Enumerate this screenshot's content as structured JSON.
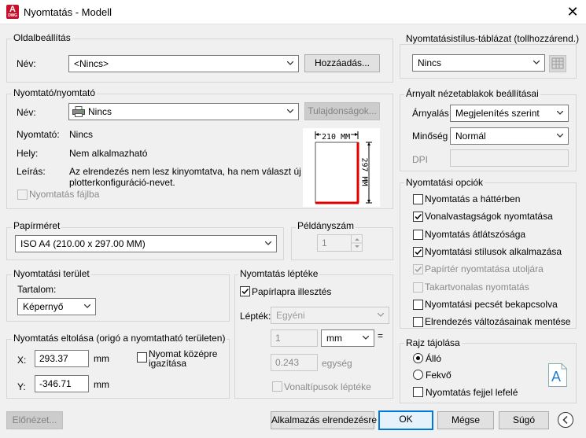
{
  "window": {
    "title": "Nyomtatás - Modell",
    "app_icon_letter": "A",
    "app_icon_sub": "DWG",
    "close": "✕"
  },
  "page_setup": {
    "title": "Oldalbeállítás",
    "name_label": "Név:",
    "name_value": "<Nincs>",
    "add_button": "Hozzáadás..."
  },
  "printer": {
    "title": "Nyomtató/nyomtató",
    "name_label": "Név:",
    "name_value": "Nincs",
    "properties_button": "Tulajdonságok...",
    "plotter_label": "Nyomtató:",
    "plotter_value": "Nincs",
    "where_label": "Hely:",
    "where_value": "Nem alkalmazható",
    "desc_label": "Leírás:",
    "desc_line1": "Az elrendezés nem lesz kinyomtatva, ha nem választ új",
    "desc_line2": "plotterkonfiguráció-nevet.",
    "plot_to_file": "Nyomtatás fájlba"
  },
  "preview": {
    "width": "210 MM",
    "height": "297 MM"
  },
  "paper_size": {
    "title": "Papírméret",
    "value": "ISO A4 (210.00 x 297.00 MM)"
  },
  "copies": {
    "title": "Példányszám",
    "value": "1"
  },
  "plot_area": {
    "title": "Nyomtatási terület",
    "what_label": "Tartalom:",
    "what_value": "Képernyő"
  },
  "plot_offset": {
    "title": "Nyomtatás eltolása (origó a nyomtatható területen)",
    "x_label": "X:",
    "x_value": "293.37",
    "x_unit": "mm",
    "y_label": "Y:",
    "y_value": "-346.71",
    "y_unit": "mm",
    "center_line1": "Nyomat középre",
    "center_line2": "igazítása"
  },
  "plot_scale": {
    "title": "Nyomtatás léptéke",
    "fit_to_paper": "Papírlapra illesztés",
    "scale_label": "Lépték:",
    "scale_value": "Egyéni",
    "value1": "1",
    "unit_value": "mm",
    "equals": "=",
    "value2": "0.243",
    "unit2": "egység",
    "scale_lineweights": "Vonaltípusok léptéke"
  },
  "plot_style": {
    "title": "Nyomtatásistílus-táblázat (tollhozzárend.)",
    "value": "Nincs"
  },
  "shaded": {
    "title": "Árnyalt nézetablakok beállításai",
    "shade_label": "Árnyalás",
    "shade_value": "Megjelenítés szerint",
    "quality_label": "Minőség",
    "quality_value": "Normál",
    "dpi_label": "DPI"
  },
  "options": {
    "title": "Nyomtatási opciók",
    "items": [
      {
        "label": "Nyomtatás a háttérben",
        "checked": false,
        "disabled": false
      },
      {
        "label": "Vonalvastagságok nyomtatása",
        "checked": true,
        "disabled": false
      },
      {
        "label": "Nyomtatás átlátszósága",
        "checked": false,
        "disabled": false
      },
      {
        "label": "Nyomtatási stílusok alkalmazása",
        "checked": true,
        "disabled": false
      },
      {
        "label": "Papírtér nyomtatása utoljára",
        "checked": true,
        "disabled": true
      },
      {
        "label": "Takartvonalas nyomtatás",
        "checked": false,
        "disabled": true
      },
      {
        "label": "Nyomtatási pecsét bekapcsolva",
        "checked": false,
        "disabled": false
      },
      {
        "label": "Elrendezés változásainak mentése",
        "checked": false,
        "disabled": false
      }
    ]
  },
  "orientation": {
    "title": "Rajz tájolása",
    "portrait": "Álló",
    "landscape": "Fekvő",
    "upside_down": "Nyomtatás fejjel lefelé",
    "icon_letter": "A"
  },
  "footer": {
    "preview": "Előnézet...",
    "apply": "Alkalmazás elrendezésre",
    "ok": "OK",
    "cancel": "Mégse",
    "help": "Súgó"
  }
}
